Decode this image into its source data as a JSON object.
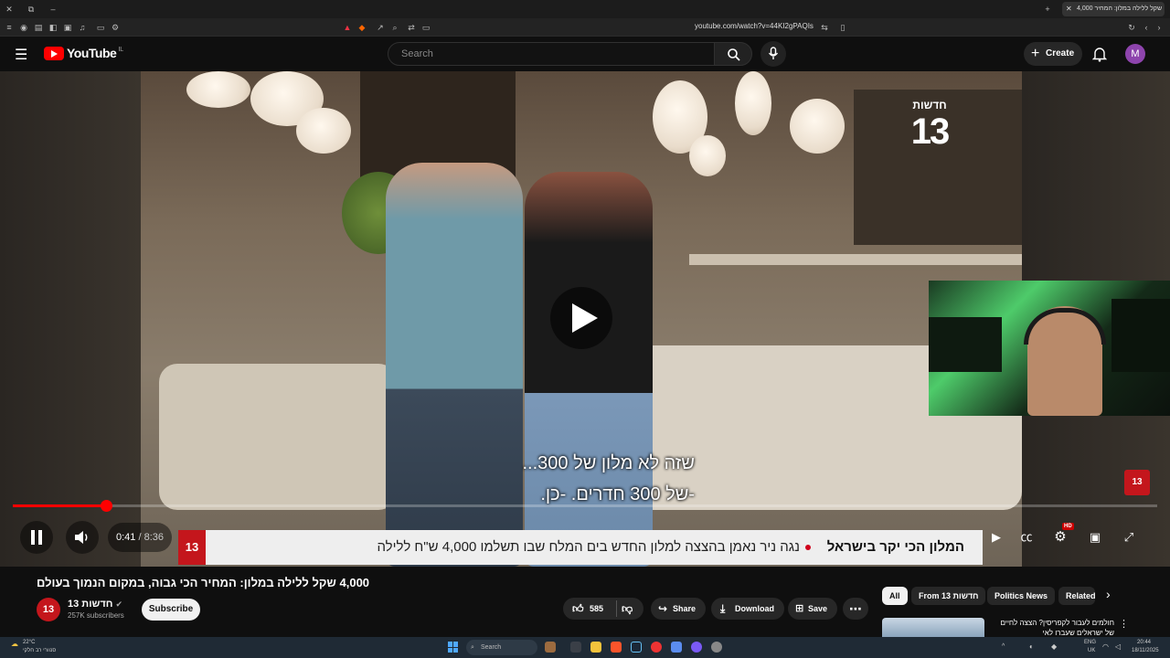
{
  "browser": {
    "tab_title": "4,000 שקל ללילה במלון: המחיר",
    "url": "youtube.com/watch?v=44KI2gPAQIs"
  },
  "youtube": {
    "logo_text": "YouTube",
    "country_code": "IL",
    "search_placeholder": "Search",
    "create_label": "Create",
    "avatar_letter": "M"
  },
  "video": {
    "channel_watermark_top": "חדשות",
    "channel_watermark_num": "13",
    "subtitle_line1": "שזה לא מלון של 300...",
    "subtitle_line2": "-של 300 חדרים. -כן.",
    "ticker_headline": "המלון הכי יקר בישראל",
    "ticker_text": "נגה ניר נאמן בהצצה למלון החדש בים המלח שבו תשלמו 4,000 ש\"ח ללילה",
    "ticker_logo": "13",
    "corner_badge": "13",
    "progress_fraction": 0.0815,
    "current_time": "0:41",
    "separator": " / ",
    "duration": "8:36",
    "hd_badge": "HD"
  },
  "below": {
    "title": "4,000 שקל ללילה במלון: המחיר הכי גבוה, במקום הנמוך בעולם",
    "channel_name": "חדשות 13",
    "channel_avatar_text": "13",
    "subscribers": "257K subscribers",
    "subscribe_label": "Subscribe",
    "likes": "585",
    "share_label": "Share",
    "download_label": "Download",
    "save_label": "Save"
  },
  "chips": [
    "All",
    "From 13 חדשות",
    "Politics News",
    "Related"
  ],
  "sidebar_video_title": "חולמים לעבור לקפריסין? הצצה לחיים של ישראלים שעברו לאי",
  "taskbar": {
    "weather_temp": "22°C",
    "weather_desc": "סנוורי רב חלקי",
    "search_label": "Search",
    "lang_top": "ENG",
    "lang_bottom": "UK",
    "time": "20:44",
    "date": "18/11/2025"
  },
  "colors": {
    "yt_red": "#ff0000",
    "channel_red": "#c4161c",
    "background": "#0f0f0f"
  }
}
